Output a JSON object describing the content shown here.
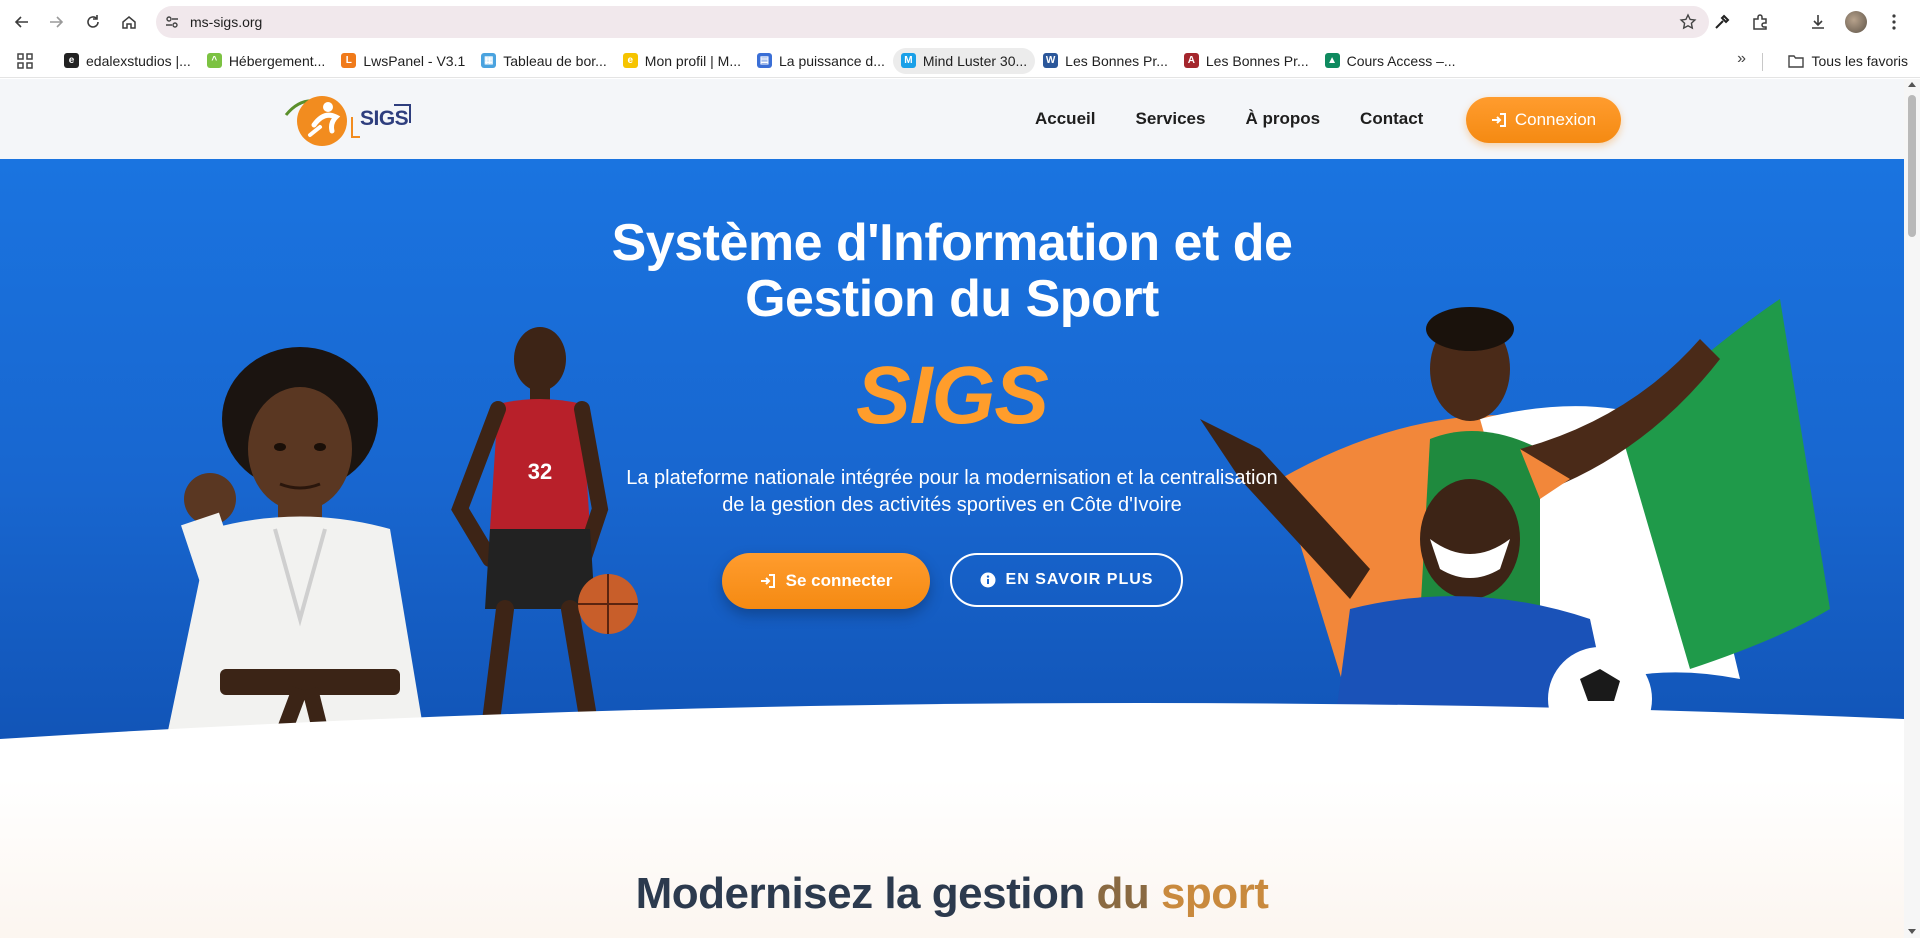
{
  "browser": {
    "url": "ms-sigs.org",
    "bookmarks": [
      {
        "label": "edalexstudios |...",
        "color": "#222222",
        "glyph": "e"
      },
      {
        "label": "Hébergement...",
        "color": "#7cc242",
        "glyph": "^"
      },
      {
        "label": "LwsPanel - V3.1",
        "color": "#f07a1a",
        "glyph": "L"
      },
      {
        "label": "Tableau de bor...",
        "color": "#4aa3df",
        "glyph": "▦"
      },
      {
        "label": "Mon profil | M...",
        "color": "#f6c400",
        "glyph": "e"
      },
      {
        "label": "La puissance d...",
        "color": "#3b6fd6",
        "glyph": "▤"
      },
      {
        "label": "Mind Luster 30...",
        "color": "#1aa0e8",
        "glyph": "M"
      },
      {
        "label": "Les Bonnes Pr...",
        "color": "#2b579a",
        "glyph": "W"
      },
      {
        "label": "Les Bonnes Pr...",
        "color": "#a4262c",
        "glyph": "A"
      },
      {
        "label": "Cours Access –...",
        "color": "#0f8a5f",
        "glyph": "▲"
      }
    ],
    "all_bookmarks_label": "Tous les favoris"
  },
  "site": {
    "logo_text": "SIGS",
    "nav": [
      "Accueil",
      "Services",
      "À propos",
      "Contact"
    ],
    "login_button": "Connexion"
  },
  "hero": {
    "title_line1": "Système d'Information et de",
    "title_line2": "Gestion du Sport",
    "brand": "SIGS",
    "subtitle_line1": "La plateforme nationale intégrée pour la modernisation et la centralisation",
    "subtitle_line2": "de la gestion des activités sportives en Côte d'Ivoire",
    "primary_button": "Se connecter",
    "secondary_button": "EN SAVOIR PLUS",
    "jersey_number": "32"
  },
  "section": {
    "title_part1": "Modernisez la gestion",
    "title_part2": "du",
    "title_part3": "sport"
  },
  "colors": {
    "accent_orange": "#f58a12",
    "hero_blue": "#1a6fdc",
    "heading_dark": "#2c3a4e"
  }
}
